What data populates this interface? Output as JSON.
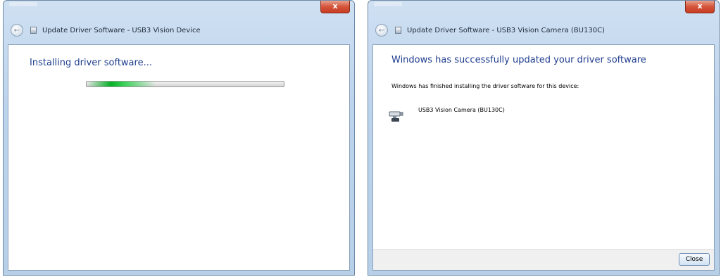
{
  "left_dialog": {
    "title": "Update Driver Software - USB3 Vision Device",
    "close_glyph": "x",
    "heading": "Installing driver software...",
    "progress": 0.35,
    "icons": {
      "back": "back-arrow-icon",
      "device": "device-icon",
      "close": "window-close-icon"
    }
  },
  "right_dialog": {
    "title": "Update Driver Software - USB3 Vision Camera (BU130C)",
    "close_glyph": "x",
    "heading": "Windows has successfully updated your driver software",
    "message": "Windows has finished installing the driver software for this device:",
    "device_name": "USB3 Vision Camera (BU130C)",
    "close_button_label": "Close",
    "icons": {
      "back": "back-arrow-icon",
      "device": "device-icon",
      "camera": "camera-device-icon",
      "close": "window-close-icon"
    }
  },
  "colors": {
    "heading_blue": "#1e3d8e",
    "progress_green": "#06b025",
    "close_red": "#c73d22",
    "frame_blue": "#bcd3ec"
  }
}
